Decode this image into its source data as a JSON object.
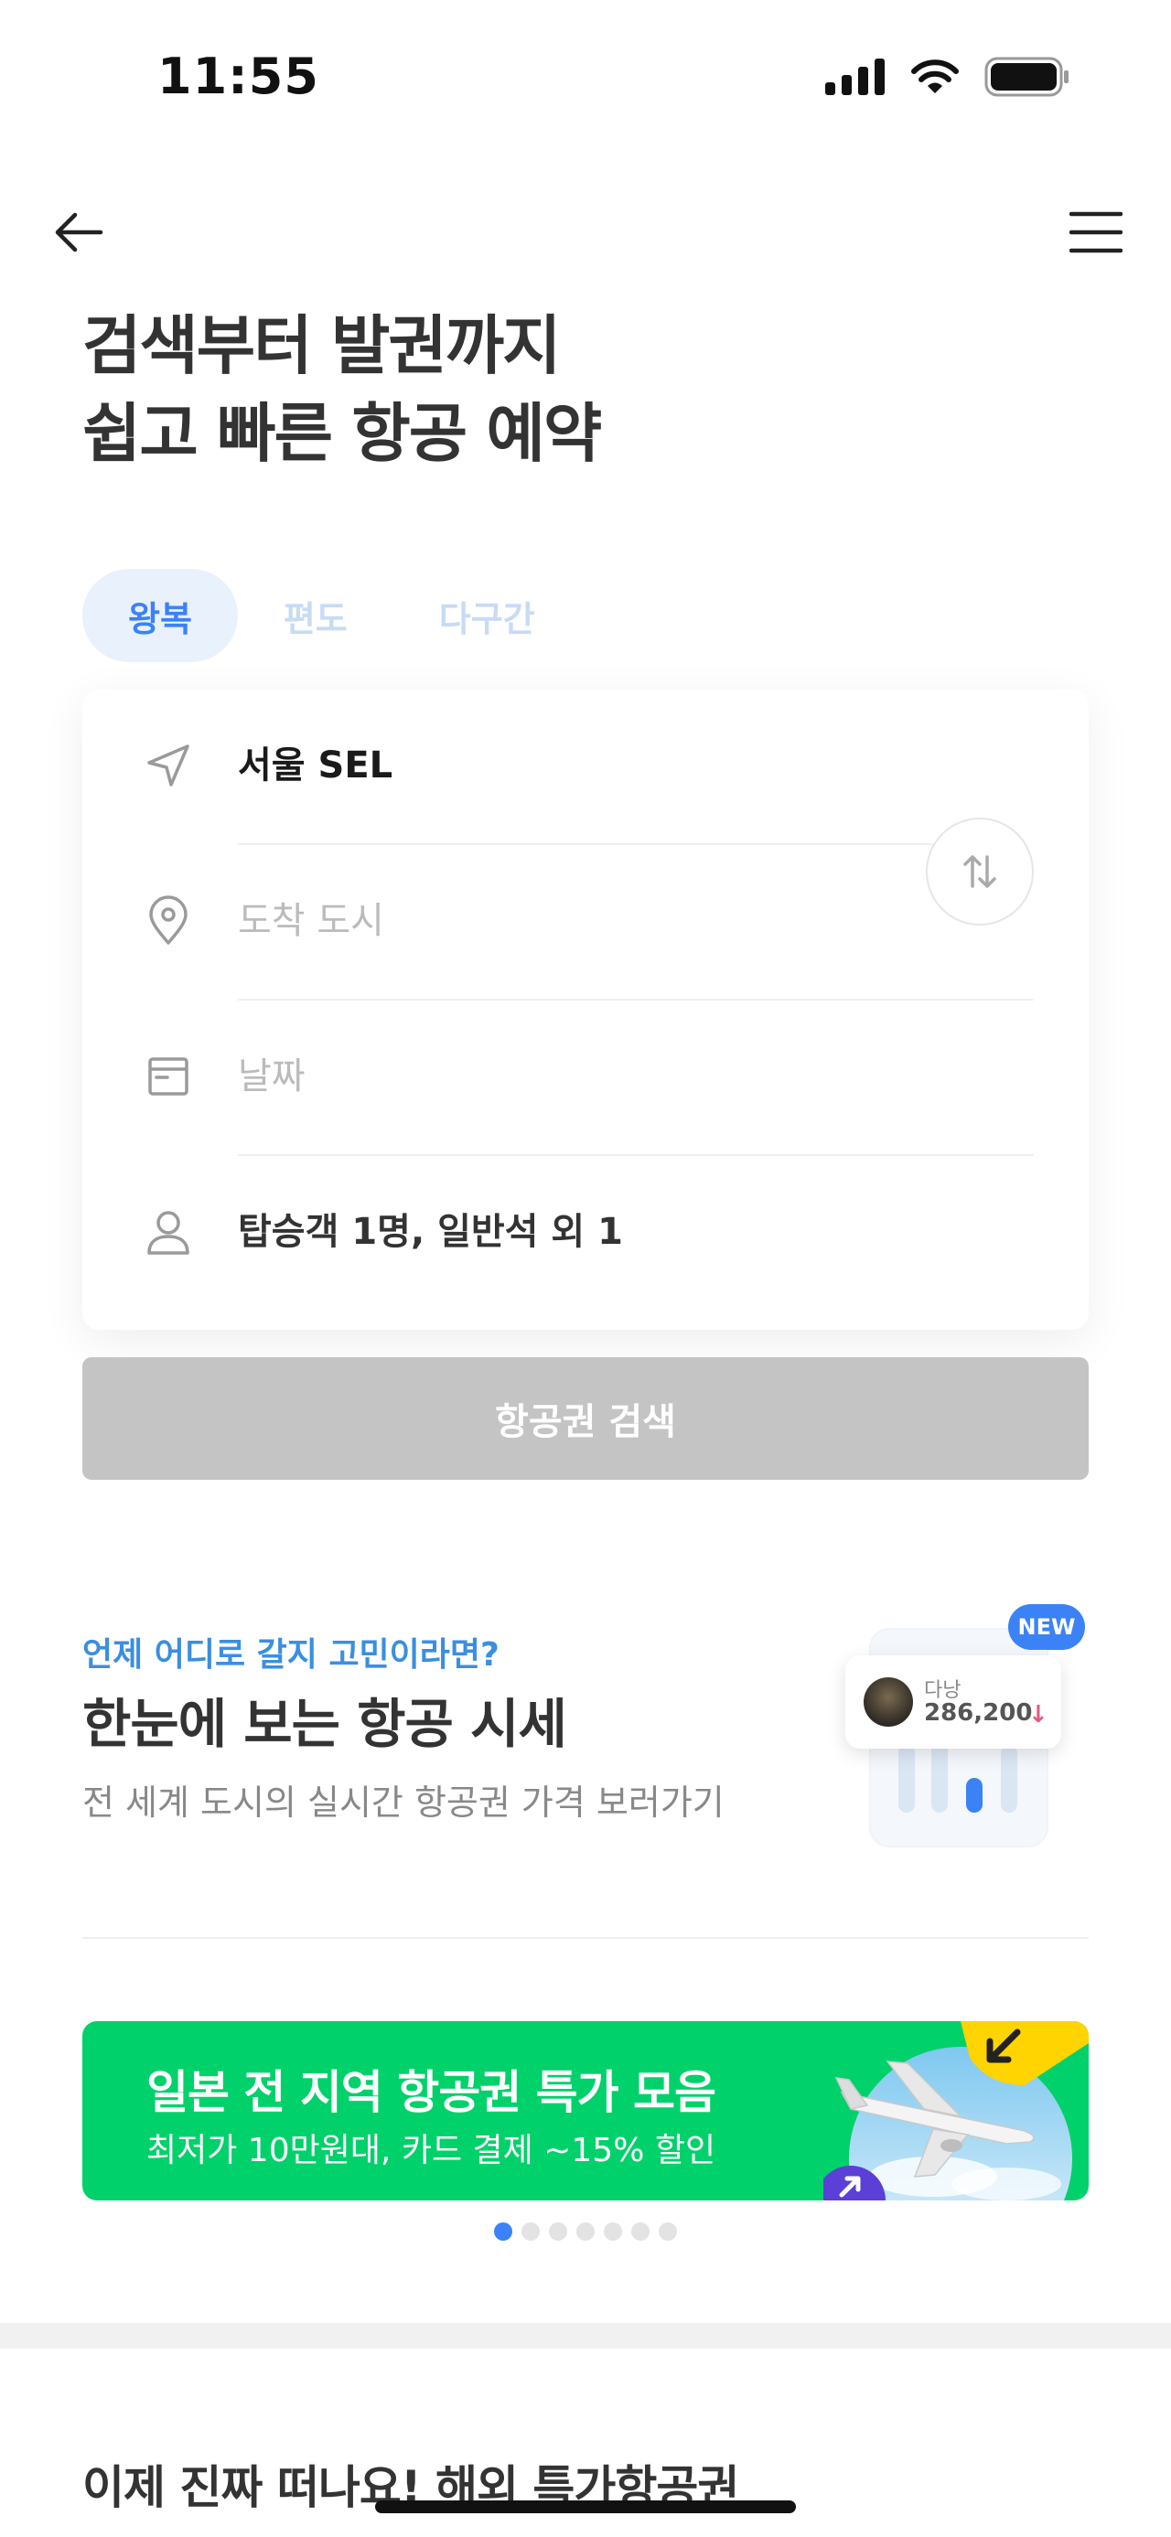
{
  "status_bar": {
    "time": "11:55"
  },
  "header": {
    "headline_line1": "검색부터 발권까지",
    "headline_line2": "쉽고 빠른 항공 예약"
  },
  "trip_tabs": [
    {
      "label": "왕복",
      "active": true
    },
    {
      "label": "편도",
      "active": false
    },
    {
      "label": "다구간",
      "active": false
    }
  ],
  "search_form": {
    "departure": "서울 SEL",
    "arrival_placeholder": "도착 도시",
    "date_placeholder": "날짜",
    "passengers": "탑승객 1명, 일반석 외 1"
  },
  "search_button_label": "항공권 검색",
  "price_trends": {
    "eyebrow": "언제 어디로 갈지 고민이라면?",
    "title": "한눈에 보는 항공 시세",
    "subtitle": "전 세계 도시의 실시간 항공권 가격 보러가기",
    "badge": "NEW",
    "sample_city": "다낭",
    "sample_price": "286,200",
    "trend": "down"
  },
  "promo_banner": {
    "title": "일본 전 지역 항공권 특가 모음",
    "subtitle": "최저가 10만원대, 카드 결제 ~15% 할인",
    "color": "#00d16a"
  },
  "carousel": {
    "total": 7,
    "active_index": 0
  },
  "deals_section": {
    "heading": "이제 진짜 떠나요! 해외 특가항공권"
  },
  "colors": {
    "accent": "#3b82f6",
    "disabled_button": "#c4c4c4"
  }
}
